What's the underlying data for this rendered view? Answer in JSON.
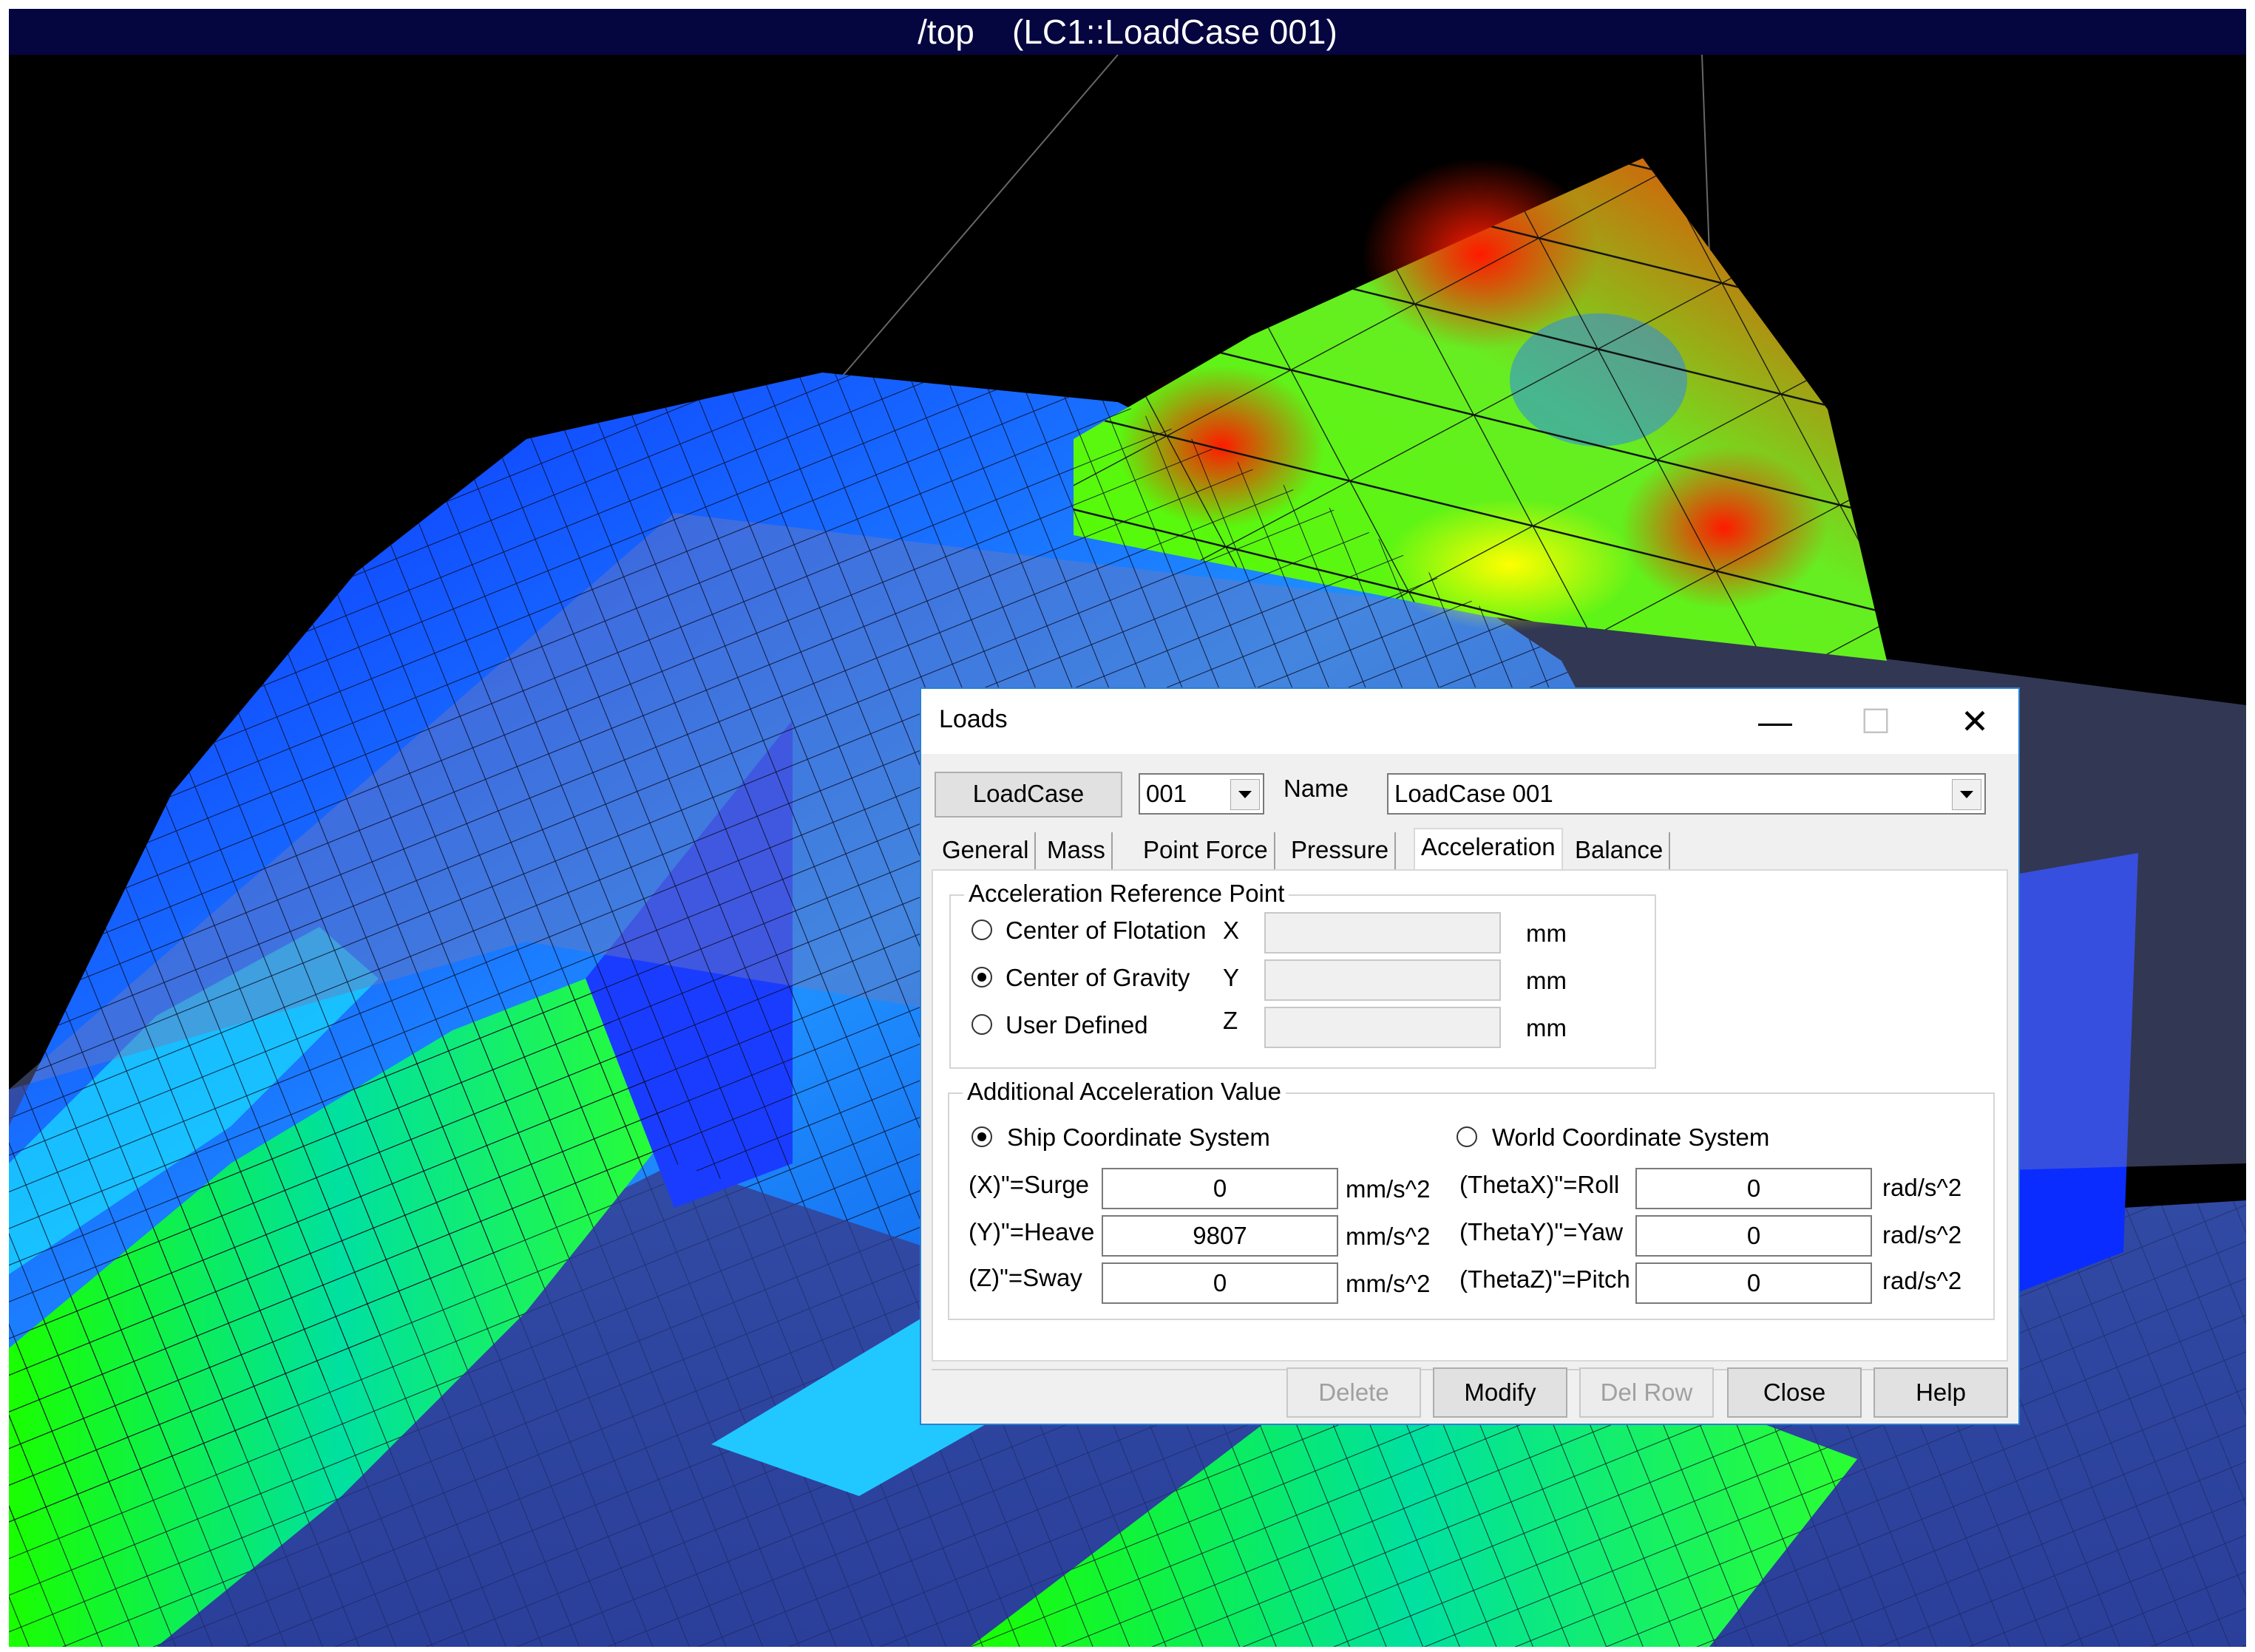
{
  "viewport": {
    "title": "/top    (LC1::LoadCase 001)"
  },
  "dialog": {
    "title": "Loads",
    "window_buttons": {
      "minimize": "—",
      "maximize": "☐",
      "close": "✕"
    },
    "loadcase_button": "LoadCase",
    "loadcase_select": "001",
    "name_label": "Name",
    "name_value": "LoadCase 001",
    "tabs": [
      "General",
      "Mass",
      "Point Force",
      "Pressure",
      "Acceleration",
      "Balance"
    ],
    "active_tab": "Acceleration",
    "reference_point": {
      "title": "Acceleration Reference Point",
      "options": [
        {
          "label": "Center of Flotation",
          "axis": "X",
          "value": "",
          "unit": "mm",
          "checked": false
        },
        {
          "label": "Center of Gravity",
          "axis": "Y",
          "value": "",
          "unit": "mm",
          "checked": true
        },
        {
          "label": "User Defined",
          "axis": "Z",
          "value": "",
          "unit": "mm",
          "checked": false
        }
      ]
    },
    "additional": {
      "title": "Additional Acceleration Value",
      "ship_cs": "Ship Coordinate System",
      "world_cs": "World Coordinate System",
      "ship_checked": true,
      "rows": [
        {
          "label": "(X)\"=Surge",
          "value": "0",
          "unit": "mm/s^2",
          "rot_label": "(ThetaX)\"=Roll",
          "rot_value": "0",
          "rot_unit": "rad/s^2"
        },
        {
          "label": "(Y)\"=Heave",
          "value": "9807",
          "unit": "mm/s^2",
          "rot_label": "(ThetaY)\"=Yaw",
          "rot_value": "0",
          "rot_unit": "rad/s^2"
        },
        {
          "label": "(Z)\"=Sway",
          "value": "0",
          "unit": "mm/s^2",
          "rot_label": "(ThetaZ)\"=Pitch",
          "rot_value": "0",
          "rot_unit": "rad/s^2"
        }
      ]
    },
    "buttons": {
      "delete": "Delete",
      "modify": "Modify",
      "del_row": "Del Row",
      "close": "Close",
      "help": "Help"
    }
  }
}
